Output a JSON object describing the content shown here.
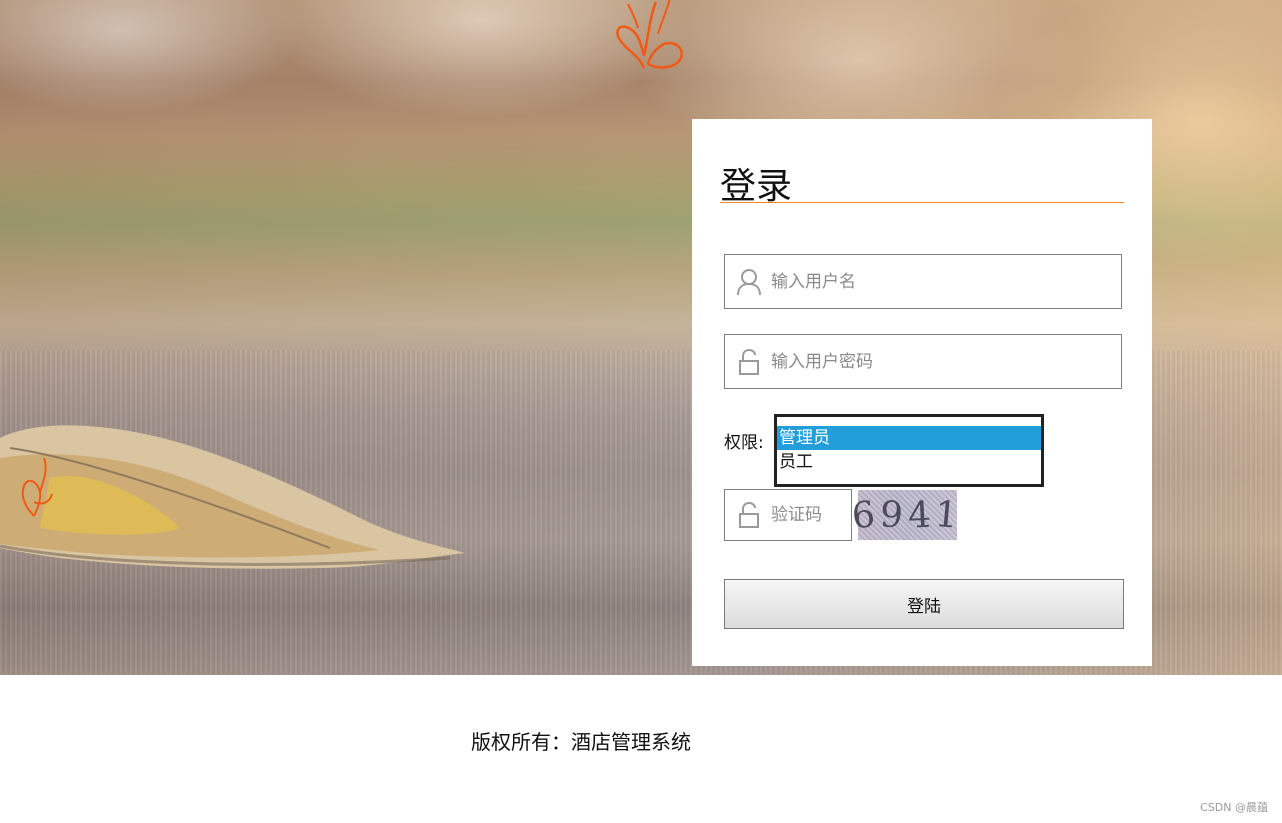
{
  "background": {
    "description_colors": [
      "#b99b7e",
      "#9ea273",
      "#a89b97"
    ]
  },
  "login": {
    "title": "登录",
    "accent_color": "#f08a24",
    "username": {
      "placeholder": "输入用户名",
      "icon": "user-icon"
    },
    "password": {
      "placeholder": "输入用户密码",
      "icon": "lock-icon"
    },
    "role": {
      "label": "权限:",
      "options": [
        "管理员",
        "员工"
      ],
      "selected": "管理员",
      "selected_color": "#229fdb"
    },
    "captcha": {
      "placeholder": "验证码",
      "icon": "lock-icon",
      "image_text": [
        "6",
        "9",
        "4",
        "1"
      ]
    },
    "submit_label": "登陆"
  },
  "footer": {
    "copyright": "版权所有：酒店管理系统"
  },
  "watermark": "CSDN @晨蕴"
}
